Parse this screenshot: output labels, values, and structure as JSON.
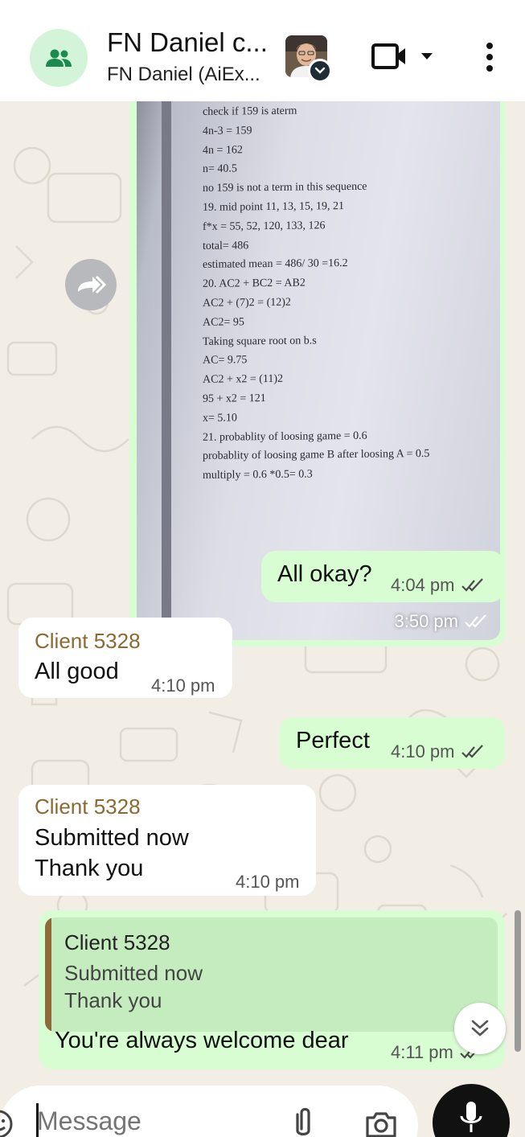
{
  "header": {
    "title": "FN Daniel c...",
    "subtitle": "FN Daniel (AiEx...",
    "icons": [
      "group-icon",
      "video-call-icon",
      "chevron-down-icon",
      "more-vert-icon"
    ]
  },
  "photo_message": {
    "lines": [
      "check if 159 is aterm",
      "4n-3 = 159",
      "4n = 162",
      "n= 40.5",
      "no 159 is not a term in this sequence",
      "19. mid point  11, 13, 15, 19, 21",
      "f*x = 55, 52, 120, 133, 126",
      "total= 486",
      "estimated mean = 486/ 30 =16.2",
      "20. AC2 + BC2 = AB2",
      "AC2 + (7)2 = (12)2",
      "AC2= 95",
      "Taking square root on b.s",
      "AC= 9.75",
      "AC2 + x2 = (11)2",
      "95 + x2 = 121",
      "x= 5.10",
      "21. probablity of loosing game = 0.6",
      "probablity of loosing game B after loosing A = 0.5",
      "multiply = 0.6 *0.5= 0.3"
    ],
    "time": "3:50 pm"
  },
  "messages": [
    {
      "direction": "out",
      "text": "All okay?",
      "time": "4:04 pm"
    },
    {
      "direction": "in",
      "sender": "Client 5328",
      "text": "All good",
      "time": "4:10 pm"
    },
    {
      "direction": "out",
      "text": "Perfect",
      "time": "4:10 pm"
    },
    {
      "direction": "in",
      "sender": "Client 5328",
      "lines": [
        "Submitted now",
        "Thank you"
      ],
      "time": "4:10 pm"
    },
    {
      "direction": "out",
      "quote": {
        "sender": "Client 5328",
        "lines": [
          "Submitted now",
          "Thank you"
        ]
      },
      "text": "You're always welcome dear",
      "time": "4:11 pm"
    }
  ],
  "input": {
    "placeholder": "Message"
  },
  "colors": {
    "outgoing_bubble": "#d8fdd2",
    "incoming_bubble": "#ffffff",
    "sender_name": "#8a6a32",
    "read_ticks": "#4a4a4a",
    "chat_background": "#f2eee6"
  }
}
